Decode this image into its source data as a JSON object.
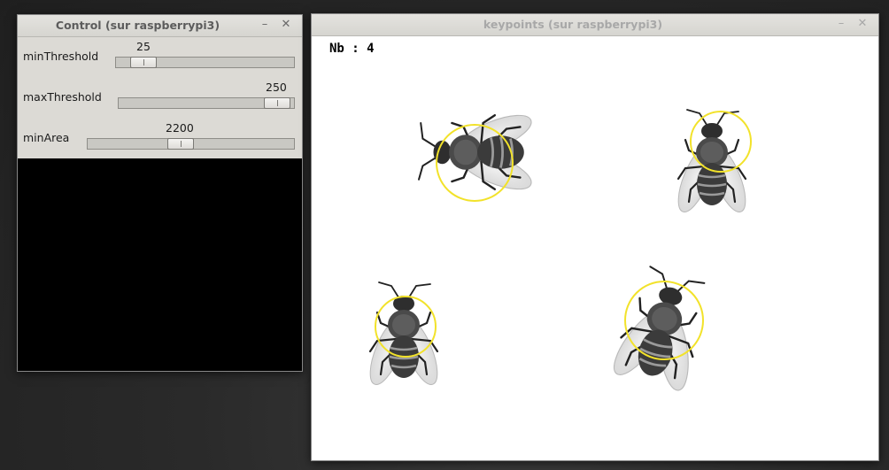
{
  "control_window": {
    "title": "Control (sur raspberrypi3)",
    "minimize_glyph": "–",
    "close_glyph": "✕",
    "trackbars": [
      {
        "label": "minThreshold",
        "value": "25",
        "fraction": 0.08
      },
      {
        "label": "maxThreshold",
        "value": "250",
        "fraction": 0.98
      },
      {
        "label": "minArea",
        "value": "2200",
        "fraction": 0.44
      }
    ]
  },
  "keypoints_window": {
    "title": "keypoints (sur raspberrypi3)",
    "minimize_glyph": "–",
    "close_glyph": "✕",
    "count_text": "Nb : 4",
    "circle_color": "#f2e22a"
  }
}
